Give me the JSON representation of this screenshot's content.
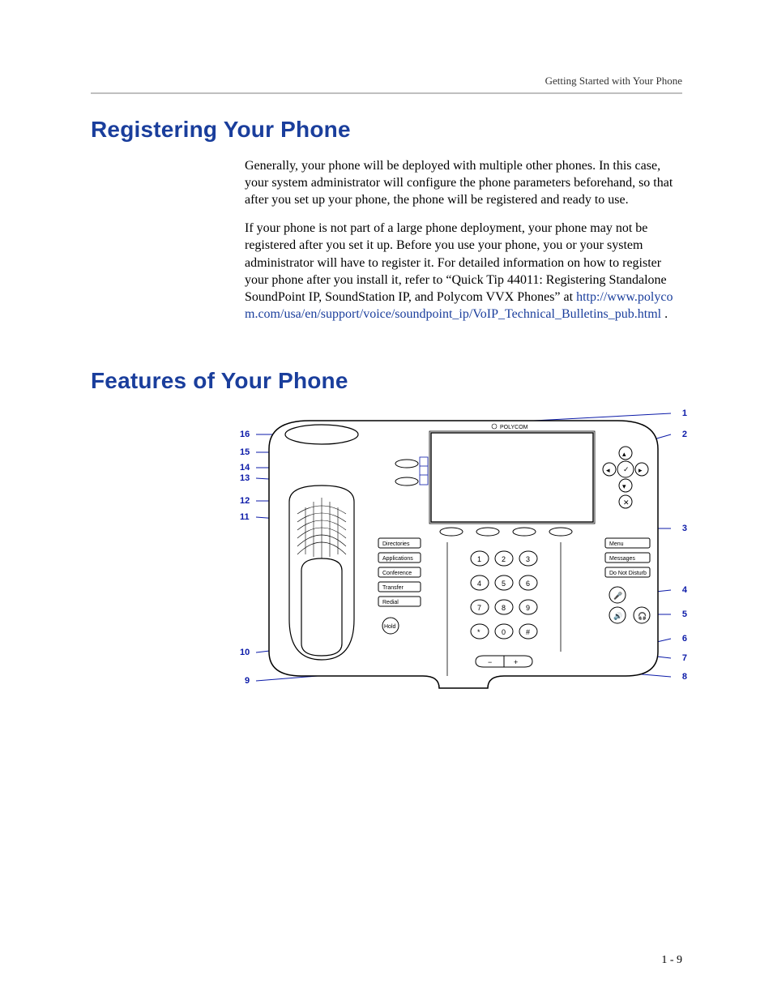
{
  "running_head": "Getting Started with Your Phone",
  "section1": {
    "title": "Registering Your Phone",
    "para1": "Generally, your phone will be deployed with multiple other phones. In this case, your system administrator will configure the phone parameters beforehand, so that after you set up your phone, the phone will be registered and ready to use.",
    "para2a": "If your phone is not part of a large phone deployment, your phone may not be registered after you set it up. Before you use your phone, you or your system administrator will have to register it. For detailed information on how to register your phone after you install it, refer to “Quick Tip 44011: Registering Standalone SoundPoint IP, SoundStation IP, and Polycom VVX Phones” at ",
    "link_text": "http://www.polycom.com/usa/en/support/voice/soundpoint_ip/VoIP_Technical_Bulletins_pub.html",
    "para2b": " ."
  },
  "section2": {
    "title": "Features of Your Phone"
  },
  "phone_diagram": {
    "brand": "POLYCOM",
    "feature_buttons_left": [
      "Directories",
      "Applications",
      "Conference",
      "Transfer",
      "Redial"
    ],
    "hold_label": "Hold",
    "feature_buttons_right": [
      "Menu",
      "Messages",
      "Do Not Disturb"
    ],
    "dialpad": [
      [
        "1",
        "2",
        "3"
      ],
      [
        "4",
        "5",
        "6"
      ],
      [
        "7",
        "8",
        "9"
      ],
      [
        "*",
        "0",
        "#"
      ]
    ],
    "callouts_left": {
      "c16": "16",
      "c15": "15",
      "c14": "14",
      "c13": "13",
      "c12": "12",
      "c11": "11",
      "c10": "10",
      "c9": "9"
    },
    "callouts_right": {
      "c1": "1",
      "c2": "2",
      "c3": "3",
      "c4": "4",
      "c5": "5",
      "c6": "6",
      "c7": "7",
      "c8": "8"
    }
  },
  "page_number": "1 - 9"
}
